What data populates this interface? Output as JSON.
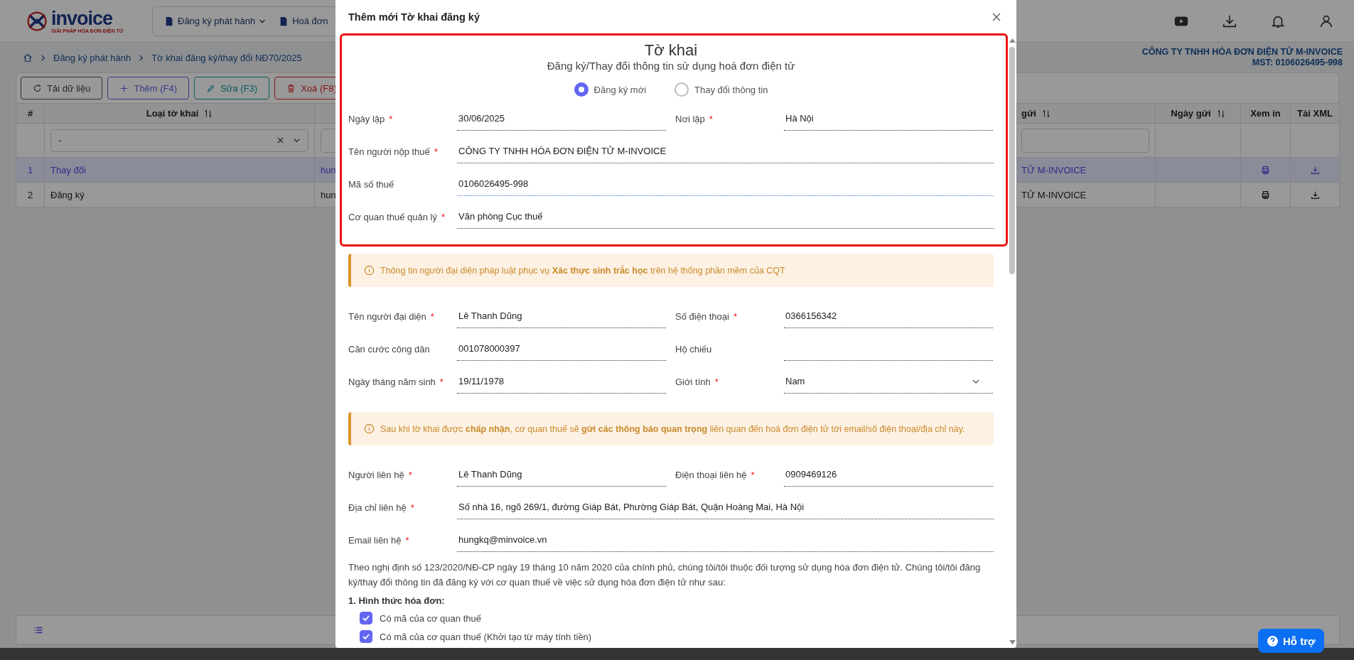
{
  "header": {
    "logo_text": "invoice",
    "logo_tagline": "GIẢI PHÁP HÓA ĐƠN ĐIỆN TỬ",
    "nav": [
      {
        "label": "Đăng ký phát hành",
        "dropdown": true
      },
      {
        "label": "Hoá đơn",
        "dropdown": false
      }
    ]
  },
  "breadcrumb": [
    "Đăng ký phát hành",
    "Tờ khai đăng ký/thay đổi NĐ70/2025"
  ],
  "company": {
    "name": "CÔNG TY TNHH HÓA ĐƠN ĐIỆN TỬ M-INVOICE",
    "tax_code": "MST: 0106026495-998"
  },
  "toolbar": [
    {
      "label": "Tải dữ liệu",
      "kind": "reload"
    },
    {
      "label": "Thêm (F4)",
      "kind": "add"
    },
    {
      "label": "Sửa (F3)",
      "kind": "edit"
    },
    {
      "label": "Xoá (F8)",
      "kind": "delete"
    }
  ],
  "table": {
    "columns": [
      {
        "label": "#",
        "sortable": false
      },
      {
        "label": "Loại tờ khai",
        "sortable": true
      },
      {
        "label": "gửi",
        "sortable": true
      },
      {
        "label": "Ngày gửi",
        "sortable": true
      },
      {
        "label": "Xem in",
        "sortable": false
      },
      {
        "label": "Tải XML",
        "sortable": false
      }
    ],
    "filter": {
      "value": "-"
    },
    "rows": [
      {
        "no": "1",
        "type": "Thay đổi",
        "column_3": "hun",
        "column_4": "TỬ M-INVOICE",
        "selected": true
      },
      {
        "no": "2",
        "type": "Đăng ký",
        "column_3": "hun",
        "column_4": "TỬ M-INVOICE",
        "selected": false
      }
    ]
  },
  "modal": {
    "title": "Thêm mới Tờ khai đăng ký",
    "heading": "Tờ khai",
    "subheading": "Đăng ký/Thay đổi thông tin sử dụng hoá đơn điện tử",
    "modes": [
      {
        "label": "Đăng ký mới",
        "selected": true
      },
      {
        "label": "Thay đổi thông tin",
        "selected": false
      }
    ],
    "sections": [
      {
        "kind": "fields",
        "highlighted": true,
        "rows": [
          [
            {
              "label": "Ngày lập",
              "required_mark": "*",
              "value": "30/06/2025",
              "kind": "text",
              "focused": false
            },
            {
              "label": "Nơi lập",
              "required_mark": "*",
              "value": "Hà Nội",
              "kind": "text",
              "focused": false
            }
          ],
          [
            {
              "label": "Tên người nộp thuế",
              "required_mark": "*",
              "value": "CÔNG TY TNHH HÓA ĐƠN ĐIỆN TỬ M-INVOICE",
              "kind": "text",
              "focused": false
            }
          ],
          [
            {
              "label": "Mã số thuế",
              "value": "0106026495-998",
              "kind": "text",
              "focused": true
            }
          ],
          [
            {
              "label": "Cơ quan thuế quản lý",
              "required_mark": "*",
              "value": "Văn phòng Cục thuế",
              "kind": "text",
              "focused": false
            }
          ]
        ]
      },
      {
        "kind": "alert",
        "text": "Thông tin người đại diện pháp luật phục vụ **Xác thực sinh trắc học** trên hệ thống phần mềm của CQT"
      },
      {
        "kind": "fields",
        "highlighted": false,
        "rows": [
          [
            {
              "label": "Tên người đại diện",
              "required_mark": "*",
              "value": "Lê Thanh Dũng",
              "kind": "text",
              "focused": false
            },
            {
              "label": "Số điện thoại",
              "required_mark": "*",
              "value": "0366156342",
              "kind": "text",
              "focused": false
            }
          ],
          [
            {
              "label": "Căn cước công dân",
              "value": "001078000397",
              "kind": "text",
              "focused": false
            },
            {
              "label": "Hộ chiếu",
              "kind": "text",
              "focused": false
            }
          ],
          [
            {
              "label": "Ngày tháng năm sinh",
              "required_mark": "*",
              "value": "19/11/1978",
              "kind": "text",
              "focused": false
            },
            {
              "label": "Giới tính",
              "required_mark": "*",
              "value": "Nam",
              "kind": "select",
              "focused": false
            }
          ]
        ]
      },
      {
        "kind": "alert",
        "text": "Sau khi tờ khai được **chấp nhận**, cơ quan thuế sẽ **gửi các thông báo quan trọng** liên quan đến hoá đơn điện tử tới email/số điện thoại/địa chỉ này."
      },
      {
        "kind": "fields",
        "highlighted": false,
        "rows": [
          [
            {
              "label": "Người liên hệ",
              "required_mark": "*",
              "value": "Lê Thanh Dũng",
              "kind": "text",
              "focused": false
            },
            {
              "label": "Điện thoại liên hệ",
              "required_mark": "*",
              "value": "0909469126",
              "kind": "text",
              "focused": false
            }
          ],
          [
            {
              "label": "Địa chỉ liên hệ",
              "required_mark": "*",
              "value": "Số nhà 16, ngõ 269/1, đường Giáp Bát, Phường Giáp Bát, Quận Hoàng Mai, Hà Nội",
              "kind": "text",
              "focused": false
            }
          ],
          [
            {
              "label": "Email liên hệ",
              "required_mark": "*",
              "value": "hungkq@minvoice.vn",
              "kind": "text",
              "focused": false
            }
          ]
        ]
      },
      {
        "kind": "paragraph",
        "text": "Theo nghị định số 123/2020/NĐ-CP ngày 19 tháng 10 năm 2020 của chính phủ, chúng tôi/tôi thuộc đối tượng sử dụng hóa đơn điện tử. Chúng tôi/tôi đăng ký/thay đổi thông tin đã đăng ký với cơ quan thuế về việc sử dụng hóa đơn điện tử như sau:"
      },
      {
        "kind": "heading",
        "text": "1. Hình thức hóa đơn:"
      },
      {
        "kind": "checks",
        "items": [
          {
            "label": "Có mã của cơ quan thuế",
            "checked": true
          },
          {
            "label": "Có mã của cơ quan thuế (Khởi tạo từ máy tính tiền)",
            "checked": true
          }
        ]
      }
    ]
  },
  "help_button": {
    "label": "Hỗ trợ"
  }
}
